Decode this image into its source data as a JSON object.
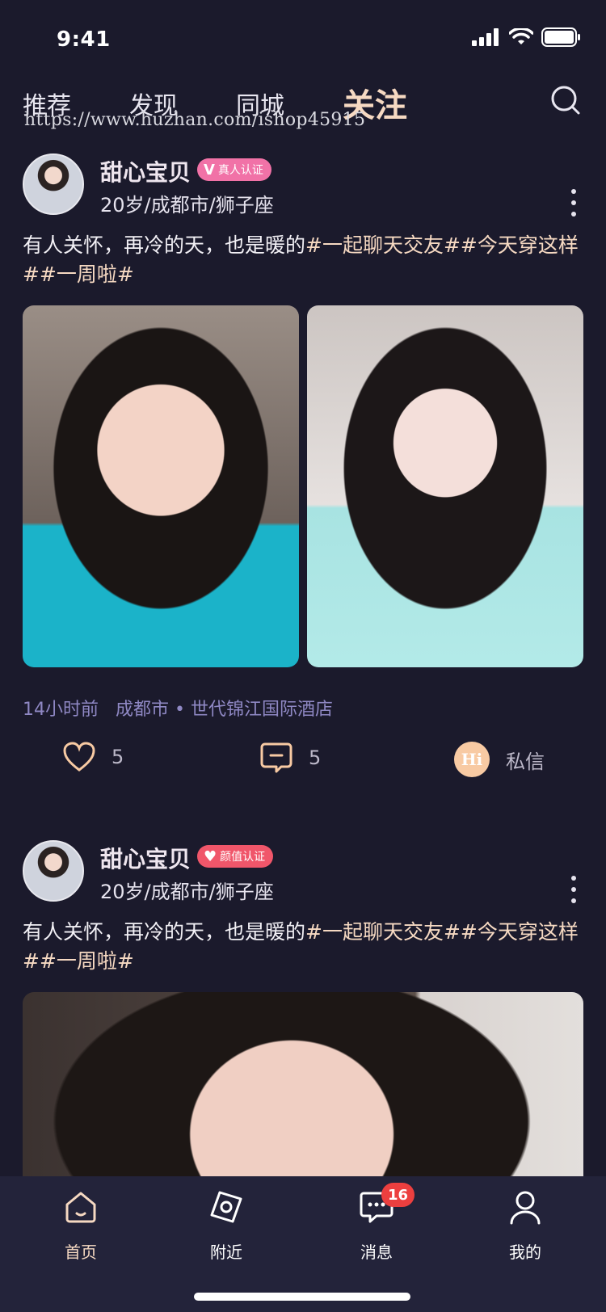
{
  "status_bar": {
    "time": "9:41"
  },
  "top_tabs": [
    "推荐",
    "发现",
    "同城",
    "关注"
  ],
  "active_tab": "关注",
  "watermark": "https://www.huzhan.com/ishop45915",
  "posts": [
    {
      "username": "甜心宝贝",
      "badge": {
        "icon": "V",
        "label": "真人认证",
        "color": "#f172a7"
      },
      "meta": "20岁/成都市/狮子座",
      "caption_text": "有人关怀，再冷的天，也是暖的",
      "caption_tags": "#一起聊天交友##今天穿这样##一周啦#",
      "time": "14小时前",
      "location": "成都市 • 世代锦江国际酒店",
      "likes": "5",
      "comments": "5",
      "dm_label": "私信",
      "dm_icon_text": "Hi"
    },
    {
      "username": "甜心宝贝",
      "badge": {
        "icon": "♥",
        "label": "颜值认证",
        "color": "#f0566a"
      },
      "meta": "20岁/成都市/狮子座",
      "caption_text": "有人关怀，再冷的天，也是暖的",
      "caption_tags": "#一起聊天交友##今天穿这样##一周啦#"
    }
  ],
  "bottom_nav": [
    {
      "label": "首页",
      "icon": "home-icon"
    },
    {
      "label": "附近",
      "icon": "nearby-icon"
    },
    {
      "label": "消息",
      "icon": "message-icon",
      "badge": "16"
    },
    {
      "label": "我的",
      "icon": "profile-icon"
    }
  ],
  "colors": {
    "background": "#1b1a2c",
    "accent": "#f6d9c2",
    "nav_bg": "#23233a",
    "badge_red": "#ec3f3f"
  }
}
